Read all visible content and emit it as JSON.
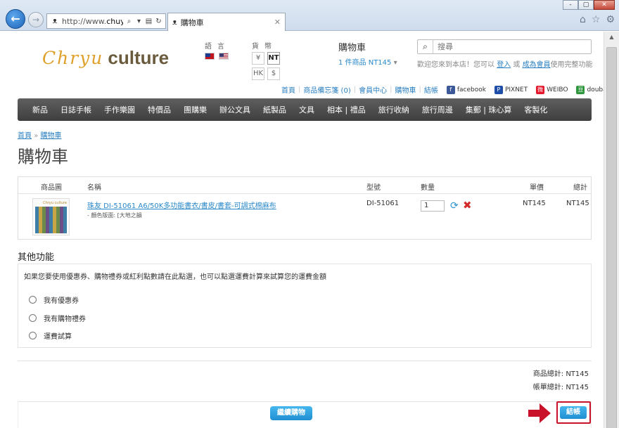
{
  "browser": {
    "window_buttons": [
      "-",
      "▢",
      "✕"
    ],
    "address": {
      "url_prefix": "http://www.",
      "url_bold": "chuy...",
      "search_glyph": "⌕",
      "dropdown_glyph": "▾",
      "compat_glyph": "▤",
      "refresh_glyph": "↻"
    },
    "tab": {
      "title": "購物車",
      "close": "✕"
    },
    "tools": [
      "⌂",
      "☆",
      "⚙"
    ]
  },
  "header": {
    "logo_script": "Chryu",
    "logo_word": "culture",
    "lang_label": "語言",
    "currency_label": "貨幣",
    "currencies": [
      "¥",
      "NT",
      "HK",
      "$"
    ],
    "cart_title": "購物車",
    "cart_summary": "1 件商品 NT145",
    "search_placeholder": "搜尋",
    "welcome_prefix": "歡迎您來到本店！您可以",
    "login": "登入",
    "or": "或",
    "register": "成為會員",
    "welcome_suffix": "使用完整功能"
  },
  "toplinks": {
    "items": [
      "首頁",
      "商品備忘箋 (0)",
      "會員中心",
      "購物車",
      "結帳"
    ],
    "social": [
      {
        "badge": "f",
        "label": "facebook",
        "color": "#3b5998"
      },
      {
        "badge": "P",
        "label": "PIXNET",
        "color": "#1f4ea8"
      },
      {
        "badge": "微",
        "label": "WEIBO",
        "color": "#e6162d"
      },
      {
        "badge": "豆",
        "label": "douban",
        "color": "#2e963d"
      }
    ]
  },
  "nav": [
    "新品",
    "日誌手帳",
    "手作樂園",
    "特價品",
    "團購樂",
    "辦公文具",
    "紙製品",
    "文具",
    "相本 | 禮品",
    "旅行收納",
    "旅行周邊",
    "集郵 | 珠心算",
    "客製化"
  ],
  "breadcrumb": {
    "home": "首頁",
    "sep": "»",
    "current": "購物車"
  },
  "page_title": "購物車",
  "cart": {
    "headers": {
      "image": "商品圖",
      "name": "名稱",
      "model": "型號",
      "qty": "數量",
      "unit": "單價",
      "total": "總計"
    },
    "item": {
      "thumb_logo": "Chryu culture",
      "name": "珠友 DI-51061 A6/50K多功能書衣/書皮/書套-可調式棉麻布",
      "option": "- 顏色版面: [大地之韻",
      "model": "DI-51061",
      "qty": "1",
      "refresh_glyph": "⟳",
      "remove_glyph": "✖",
      "unit_price": "NT145",
      "total": "NT145"
    }
  },
  "other": {
    "title": "其他功能",
    "desc": "如果您要使用優惠券、購物禮券或紅利點數請在此點選，也可以點選運費計算來試算您的運費金額",
    "options": [
      "我有優惠券",
      "我有購物禮券",
      "運費試算"
    ]
  },
  "totals": {
    "subtotal_label": "商品總計:",
    "subtotal": "NT145",
    "order_label": "帳單總計:",
    "order": "NT145"
  },
  "actions": {
    "continue": "繼續購物",
    "checkout": "結帳"
  },
  "colors": {
    "accent": "#1f8fd3",
    "highlight": "#c9112a",
    "nav_bg": "#4a4a4a"
  }
}
